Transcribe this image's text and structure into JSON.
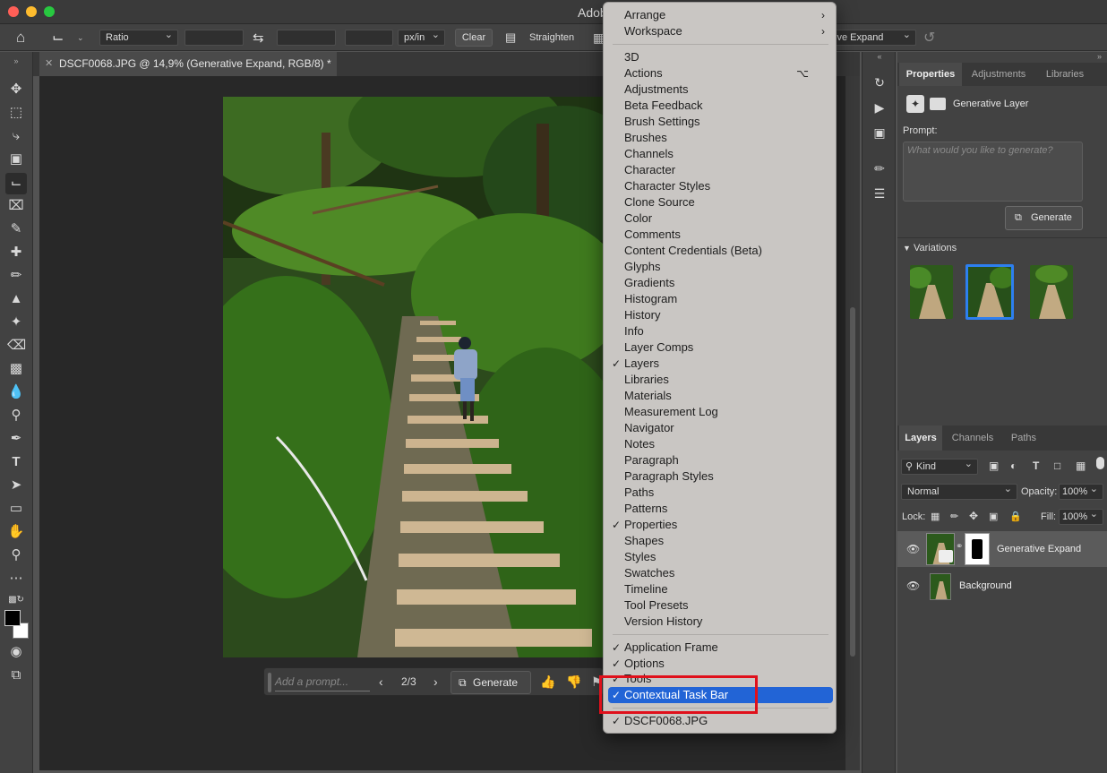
{
  "window": {
    "title": "Adob"
  },
  "options_bar": {
    "ratio": "Ratio",
    "units": "px/in",
    "clear": "Clear",
    "straighten": "Straighten",
    "fill_select": "ive Expand"
  },
  "document": {
    "tab_title": "DSCF0068.JPG @ 14,9% (Generative Expand, RGB/8) *"
  },
  "taskbar": {
    "prompt_placeholder": "Add a prompt...",
    "count": "2/3",
    "generate": "Generate"
  },
  "properties": {
    "tabs": [
      "Properties",
      "Adjustments",
      "Libraries"
    ],
    "layer_type": "Generative Layer",
    "prompt_label": "Prompt:",
    "prompt_placeholder": "What would you like to generate?",
    "generate": "Generate",
    "variations_label": "Variations"
  },
  "layers": {
    "tabs": [
      "Layers",
      "Channels",
      "Paths"
    ],
    "kind": "Kind",
    "blend_mode": "Normal",
    "opacity_label": "Opacity:",
    "opacity": "100%",
    "lock_label": "Lock:",
    "fill_label": "Fill:",
    "fill": "100%",
    "items": [
      {
        "name": "Generative Expand"
      },
      {
        "name": "Background"
      }
    ]
  },
  "menu": {
    "top": [
      {
        "label": "Arrange"
      },
      {
        "label": "Workspace"
      }
    ],
    "panels": [
      {
        "label": "3D",
        "checked": false
      },
      {
        "label": "Actions",
        "checked": false,
        "shortcut": "⌥"
      },
      {
        "label": "Adjustments",
        "checked": false
      },
      {
        "label": "Beta Feedback",
        "checked": false
      },
      {
        "label": "Brush Settings",
        "checked": false
      },
      {
        "label": "Brushes",
        "checked": false
      },
      {
        "label": "Channels",
        "checked": false
      },
      {
        "label": "Character",
        "checked": false
      },
      {
        "label": "Character Styles",
        "checked": false
      },
      {
        "label": "Clone Source",
        "checked": false
      },
      {
        "label": "Color",
        "checked": false
      },
      {
        "label": "Comments",
        "checked": false
      },
      {
        "label": "Content Credentials (Beta)",
        "checked": false
      },
      {
        "label": "Glyphs",
        "checked": false
      },
      {
        "label": "Gradients",
        "checked": false
      },
      {
        "label": "Histogram",
        "checked": false
      },
      {
        "label": "History",
        "checked": false
      },
      {
        "label": "Info",
        "checked": false
      },
      {
        "label": "Layer Comps",
        "checked": false
      },
      {
        "label": "Layers",
        "checked": true
      },
      {
        "label": "Libraries",
        "checked": false
      },
      {
        "label": "Materials",
        "checked": false
      },
      {
        "label": "Measurement Log",
        "checked": false
      },
      {
        "label": "Navigator",
        "checked": false
      },
      {
        "label": "Notes",
        "checked": false
      },
      {
        "label": "Paragraph",
        "checked": false
      },
      {
        "label": "Paragraph Styles",
        "checked": false
      },
      {
        "label": "Paths",
        "checked": false
      },
      {
        "label": "Patterns",
        "checked": false
      },
      {
        "label": "Properties",
        "checked": true
      },
      {
        "label": "Shapes",
        "checked": false
      },
      {
        "label": "Styles",
        "checked": false
      },
      {
        "label": "Swatches",
        "checked": false
      },
      {
        "label": "Timeline",
        "checked": false
      },
      {
        "label": "Tool Presets",
        "checked": false
      },
      {
        "label": "Version History",
        "checked": false
      }
    ],
    "frame": [
      {
        "label": "Application Frame",
        "checked": true
      },
      {
        "label": "Options",
        "checked": true
      },
      {
        "label": "Tools",
        "checked": true
      },
      {
        "label": "Contextual Task Bar",
        "checked": true,
        "highlighted": true
      }
    ],
    "docs": [
      {
        "label": "DSCF0068.JPG",
        "checked": true
      }
    ]
  },
  "colors": {
    "accent": "#2264d6",
    "annotation": "#e0101b"
  }
}
